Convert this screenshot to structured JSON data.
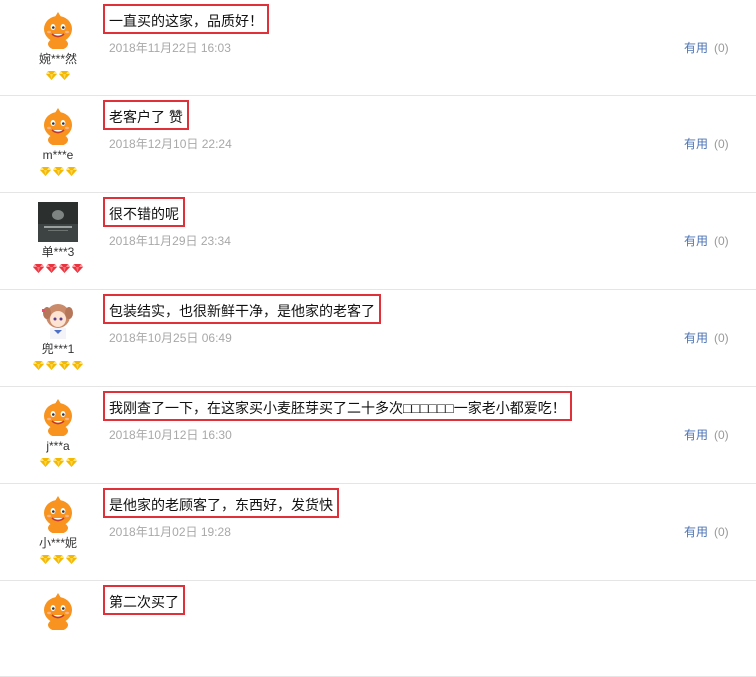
{
  "reviews": [
    {
      "username": "婉***然",
      "avatar": "orange-mascot",
      "badge_type": "gold-diamond",
      "badge_count": 2,
      "content": "一直买的这家，品质好！",
      "date": "2018年11月22日 16:03",
      "useful_label": "有用",
      "useful_count": "(0)"
    },
    {
      "username": "m***e",
      "avatar": "orange-mascot",
      "badge_type": "gold-diamond",
      "badge_count": 3,
      "content": "老客户了 赞",
      "date": "2018年12月10日 22:24",
      "useful_label": "有用",
      "useful_count": "(0)"
    },
    {
      "username": "单***3",
      "avatar": "dark-photo",
      "badge_type": "red-diamond",
      "badge_count": 4,
      "content": "很不错的呢",
      "date": "2018年11月29日 23:34",
      "useful_label": "有用",
      "useful_count": "(0)"
    },
    {
      "username": "兜***1",
      "avatar": "anime-girl",
      "badge_type": "gold-diamond",
      "badge_count": 4,
      "content": "包装结实，也很新鲜干净，是他家的老客了",
      "date": "2018年10月25日 06:49",
      "useful_label": "有用",
      "useful_count": "(0)"
    },
    {
      "username": "j***a",
      "avatar": "orange-mascot",
      "badge_type": "gold-diamond",
      "badge_count": 3,
      "content": "我刚查了一下，在这家买小麦胚芽买了二十多次□□□□□□一家老小都爱吃！",
      "date": "2018年10月12日 16:30",
      "useful_label": "有用",
      "useful_count": "(0)"
    },
    {
      "username": "小***妮",
      "avatar": "orange-mascot",
      "badge_type": "gold-diamond",
      "badge_count": 3,
      "content": "是他家的老顾客了，东西好，发货快",
      "date": "2018年11月02日 19:28",
      "useful_label": "有用",
      "useful_count": "(0)"
    },
    {
      "username": "",
      "avatar": "orange-mascot",
      "badge_type": "gold-diamond",
      "badge_count": 0,
      "content": "第二次买了",
      "date": "",
      "useful_label": "",
      "useful_count": ""
    }
  ],
  "colors": {
    "highlight_border": "#e0303a",
    "link": "#4b73b4",
    "date": "#a8a8a8",
    "mascot_orange": "#f7931e",
    "gold_badge": "#f5b800",
    "red_badge": "#e8343e"
  }
}
